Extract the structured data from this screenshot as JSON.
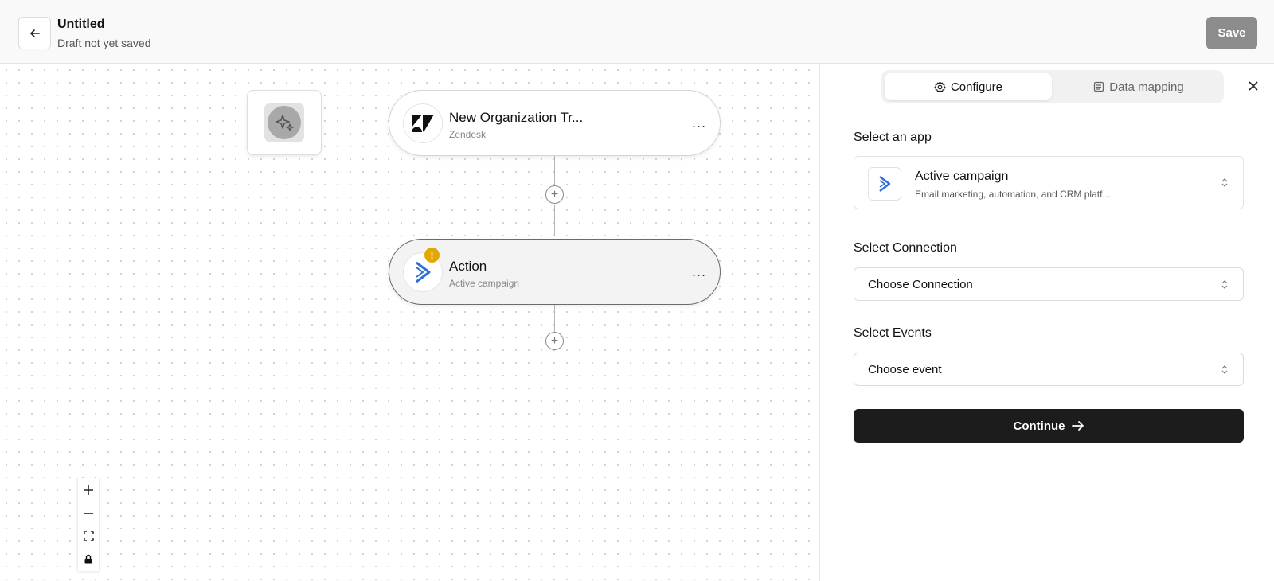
{
  "header": {
    "title": "Untitled",
    "subtitle": "Draft not yet saved",
    "save_label": "Save"
  },
  "canvas": {
    "nodes": [
      {
        "title": "New Organization Tr...",
        "app": "Zendesk",
        "logo": "zendesk-logo",
        "menu": "..."
      },
      {
        "title": "Action",
        "app": "Active campaign",
        "logo": "activecampaign-logo",
        "menu": "...",
        "warning": "!"
      }
    ],
    "add_symbol": "+"
  },
  "panel": {
    "tabs": [
      {
        "label": "Configure",
        "icon": "gear-icon",
        "selected": true
      },
      {
        "label": "Data mapping",
        "icon": "document-icon",
        "selected": false
      }
    ],
    "app_section": {
      "label": "Select an app",
      "name": "Active campaign",
      "description": "Email marketing, automation, and CRM platf..."
    },
    "connection_section": {
      "label": "Select Connection",
      "value": "Choose Connection"
    },
    "events_section": {
      "label": "Select Events",
      "value": "Choose event"
    },
    "continue_label": "Continue"
  },
  "colors": {
    "accent_blue": "#2f6fd6",
    "warning": "#e0a800",
    "primary_button": "#1c1c1c",
    "save_button": "#8c8c8c"
  }
}
